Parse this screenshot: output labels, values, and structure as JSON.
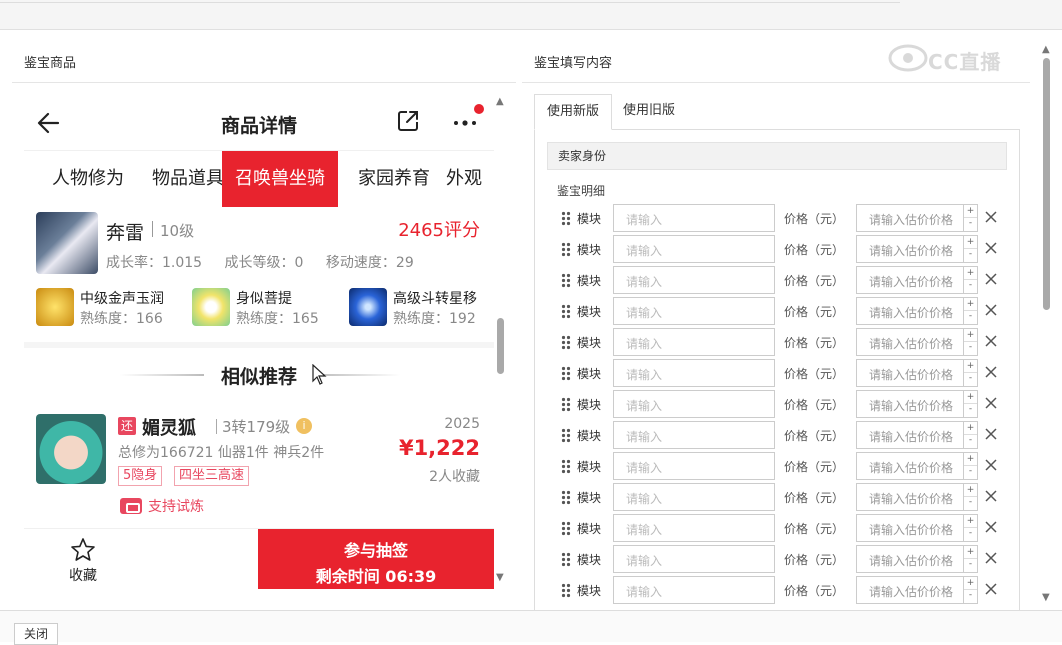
{
  "left_panel": {
    "title": "鉴宝商品"
  },
  "right_panel": {
    "title": "鉴宝填写内容"
  },
  "phone": {
    "header": {
      "title": "商品详情"
    },
    "tabs": [
      {
        "label": "人物修为"
      },
      {
        "label": "物品道具"
      },
      {
        "label": "召唤兽坐骑",
        "active": true
      },
      {
        "label": "家园养育"
      },
      {
        "label": "外观"
      }
    ],
    "mount": {
      "name": "奔雷",
      "level": "10级",
      "score": "2465评分",
      "growth_rate": "成长率：1.015",
      "growth_level": "成长等级：0",
      "move_speed": "移动速度：29"
    },
    "skills": [
      {
        "name": "中级金声玉润",
        "proficiency": "熟练度：166",
        "icon": "golden-bell-skill-icon",
        "color": "#e0b020"
      },
      {
        "name": "身似菩提",
        "proficiency": "熟练度：165",
        "icon": "bodhi-figure-skill-icon",
        "color": "#f2e46a"
      },
      {
        "name": "高级斗转星移",
        "proficiency": "熟练度：192",
        "icon": "star-swirl-skill-icon",
        "color": "#2a64d8"
      }
    ],
    "similar": {
      "title": "相似推荐"
    },
    "recommendation": {
      "badge": "还",
      "name": "媚灵狐",
      "level": "3转179级",
      "info_icon": "i",
      "year": "2025",
      "detail": "总修为166721  仙器1件  神兵2件",
      "price": "¥1,222",
      "tags": [
        "5隐身",
        "四坐三高速"
      ],
      "favorites": "2人收藏",
      "trial": "支持试炼"
    },
    "bottom": {
      "fav_label": "收藏",
      "action_line1": "参与抽签",
      "action_line2": "剩余时间 06:39"
    }
  },
  "form": {
    "tabs": [
      {
        "label": "使用新版",
        "active": true
      },
      {
        "label": "使用旧版"
      }
    ],
    "seller_section": "卖家身份",
    "detail_title": "鉴宝明细",
    "row_template": {
      "module_label": "模块",
      "module_placeholder": "请输入",
      "price_label": "价格（元）",
      "price_placeholder": "请输入估价价格",
      "plus": "+",
      "minus": "-"
    },
    "rows": [
      {
        "module_label": "模块",
        "module_placeholder": "请输入",
        "price_label": "价格（元）",
        "price_placeholder": "请输入估价价格"
      },
      {
        "module_label": "模块",
        "module_placeholder": "请输入",
        "price_label": "价格（元）",
        "price_placeholder": "请输入估价价格"
      },
      {
        "module_label": "模块",
        "module_placeholder": "请输入",
        "price_label": "价格（元）",
        "price_placeholder": "请输入估价价格"
      },
      {
        "module_label": "模块",
        "module_placeholder": "请输入",
        "price_label": "价格（元）",
        "price_placeholder": "请输入估价价格"
      },
      {
        "module_label": "模块",
        "module_placeholder": "请输入",
        "price_label": "价格（元）",
        "price_placeholder": "请输入估价价格"
      },
      {
        "module_label": "模块",
        "module_placeholder": "请输入",
        "price_label": "价格（元）",
        "price_placeholder": "请输入估价价格"
      },
      {
        "module_label": "模块",
        "module_placeholder": "请输入",
        "price_label": "价格（元）",
        "price_placeholder": "请输入估价价格"
      },
      {
        "module_label": "模块",
        "module_placeholder": "请输入",
        "price_label": "价格（元）",
        "price_placeholder": "请输入估价价格"
      },
      {
        "module_label": "模块",
        "module_placeholder": "请输入",
        "price_label": "价格（元）",
        "price_placeholder": "请输入估价价格"
      },
      {
        "module_label": "模块",
        "module_placeholder": "请输入",
        "price_label": "价格（元）",
        "price_placeholder": "请输入估价价格"
      },
      {
        "module_label": "模块",
        "module_placeholder": "请输入",
        "price_label": "价格（元）",
        "price_placeholder": "请输入估价价格"
      },
      {
        "module_label": "模块",
        "module_placeholder": "请输入",
        "price_label": "价格（元）",
        "price_placeholder": "请输入估价价格"
      },
      {
        "module_label": "模块",
        "module_placeholder": "请输入",
        "price_label": "价格（元）",
        "price_placeholder": "请输入估价价格"
      }
    ]
  },
  "watermark": {
    "text": "CC直播"
  },
  "footer": {
    "close_label": "关闭"
  },
  "colors": {
    "accent": "#e8232e",
    "tag": "#e8475f"
  }
}
